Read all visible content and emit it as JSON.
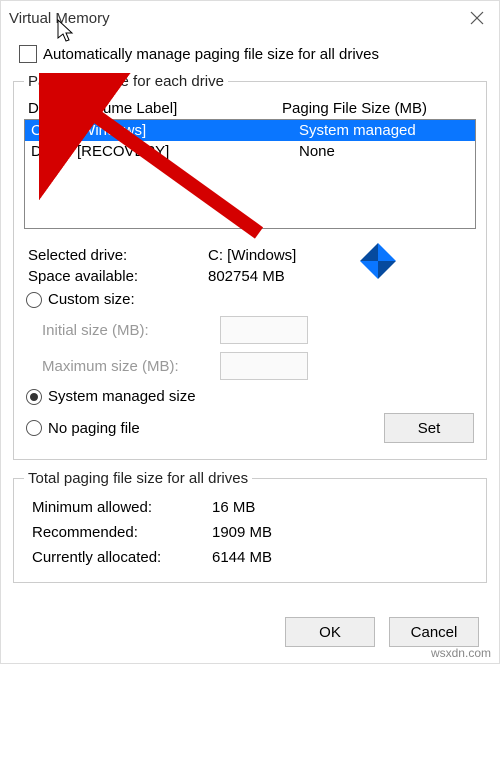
{
  "window": {
    "title": "Virtual Memory"
  },
  "auto_manage": {
    "label": "Automatically manage paging file size for all drives"
  },
  "group1": {
    "legend": "Paging file size for each drive",
    "headers": {
      "drive": "Drive",
      "volume": "[Volume Label]",
      "size": "Paging File Size (MB)"
    },
    "rows": [
      {
        "drive": "C:",
        "volume": "[Windows]",
        "size": "System managed",
        "selected": true
      },
      {
        "drive": "D:",
        "volume": "[RECOVERY]",
        "size": "None",
        "selected": false
      }
    ],
    "selected_drive": {
      "label": "Selected drive:",
      "value": "C:  [Windows]"
    },
    "space": {
      "label": "Space available:",
      "value": "802754 MB"
    },
    "custom": {
      "label": "Custom size:"
    },
    "initial": {
      "label": "Initial size (MB):"
    },
    "maximum": {
      "label": "Maximum size (MB):"
    },
    "sys_managed": {
      "label": "System managed size"
    },
    "no_paging": {
      "label": "No paging file"
    },
    "set_btn": "Set"
  },
  "group2": {
    "legend": "Total paging file size for all drives",
    "min": {
      "label": "Minimum allowed:",
      "value": "16 MB"
    },
    "rec": {
      "label": "Recommended:",
      "value": "1909 MB"
    },
    "cur": {
      "label": "Currently allocated:",
      "value": "6144 MB"
    }
  },
  "footer": {
    "ok": "OK",
    "cancel": "Cancel"
  },
  "watermark": "wsxdn.com"
}
